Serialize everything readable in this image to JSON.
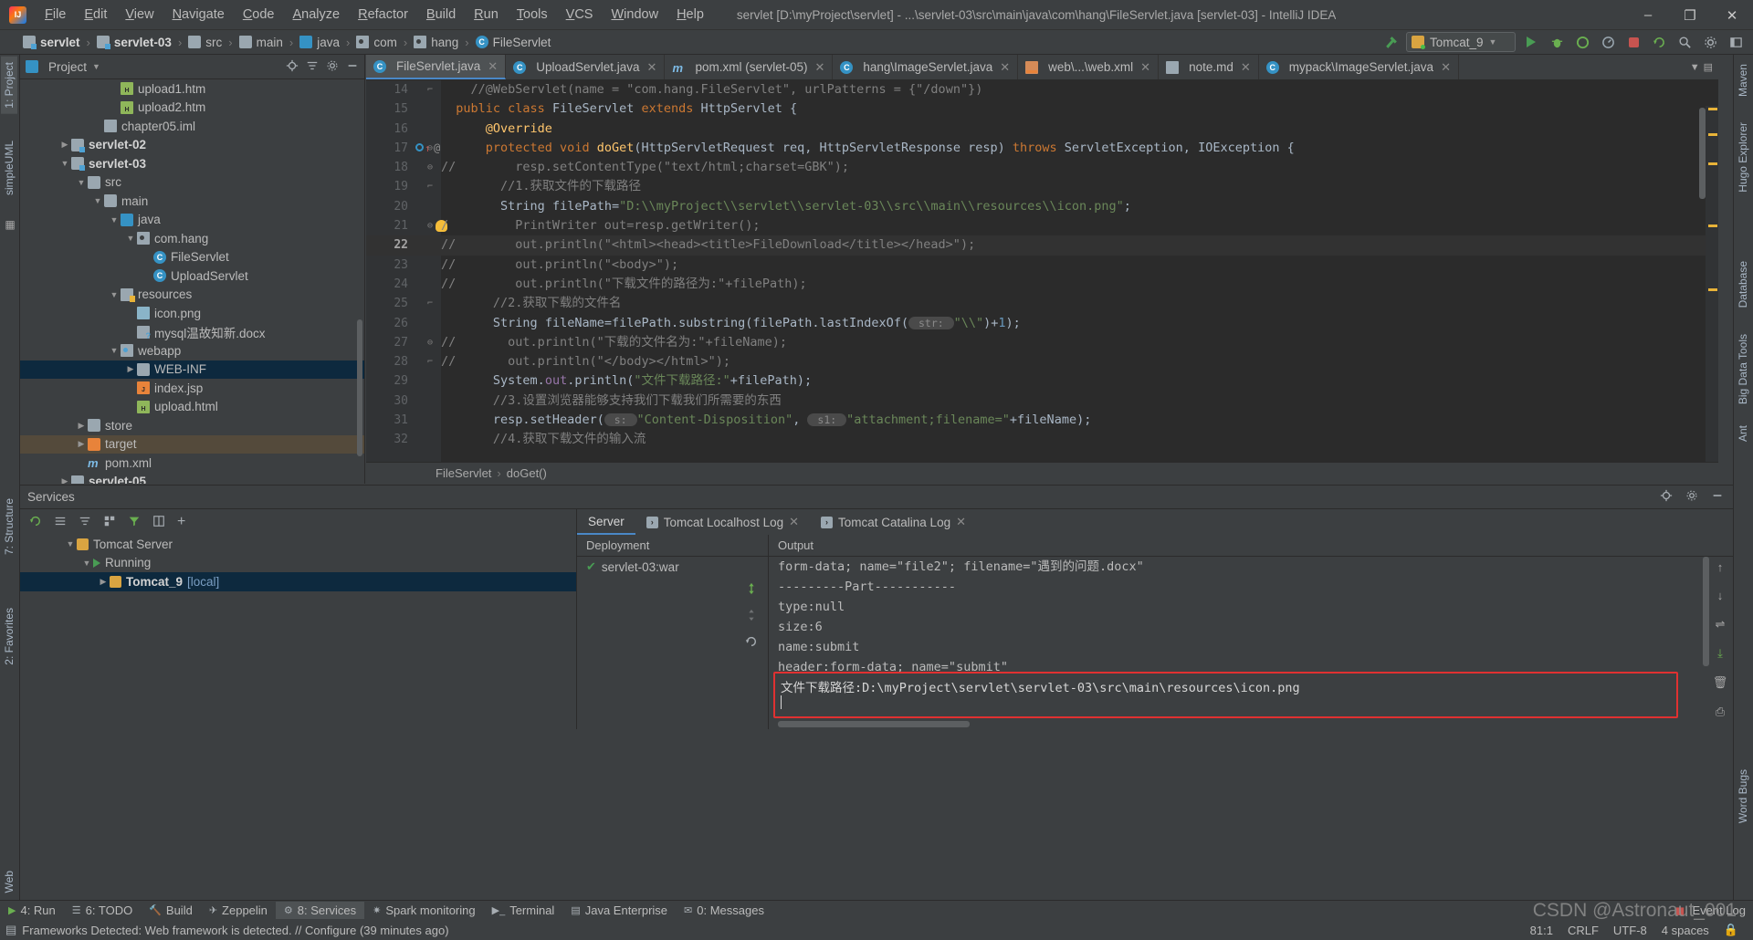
{
  "window": {
    "title": "servlet [D:\\myProject\\servlet] - ...\\servlet-03\\src\\main\\java\\com\\hang\\FileServlet.java [servlet-03] - IntelliJ IDEA",
    "minimize": "–",
    "maximize": "❐",
    "close": "✕"
  },
  "menu": [
    "File",
    "Edit",
    "View",
    "Navigate",
    "Code",
    "Analyze",
    "Refactor",
    "Build",
    "Run",
    "Tools",
    "VCS",
    "Window",
    "Help"
  ],
  "breadcrumbs": [
    {
      "label": "servlet",
      "icon": "module-folder-icon",
      "bold": true
    },
    {
      "label": "servlet-03",
      "icon": "module-folder-icon",
      "bold": true
    },
    {
      "label": "src",
      "icon": "folder-icon",
      "bold": false
    },
    {
      "label": "main",
      "icon": "folder-icon",
      "bold": false
    },
    {
      "label": "java",
      "icon": "source-folder-icon",
      "bold": false
    },
    {
      "label": "com",
      "icon": "package-icon",
      "bold": false
    },
    {
      "label": "hang",
      "icon": "package-icon",
      "bold": false
    },
    {
      "label": "FileServlet",
      "icon": "class-icon",
      "bold": false
    }
  ],
  "toolbar": {
    "run_config": "Tomcat_9",
    "build_hammer": "build-icon",
    "run": "run-icon",
    "debug": "debug-icon",
    "coverage": "coverage-icon",
    "profile": "profile-icon",
    "stop": "stop-icon",
    "updateapp": "update-app-icon",
    "search": "search-icon",
    "settings": "settings-icon",
    "layout": "layout-icon"
  },
  "project_panel": {
    "title": "Project",
    "tree": [
      {
        "label": "upload1.htm",
        "indent": 5,
        "arrow": "none",
        "icon": "html-file-icon",
        "bold": false,
        "state": "normal"
      },
      {
        "label": "upload2.htm",
        "indent": 5,
        "arrow": "none",
        "icon": "html-file-icon",
        "bold": false,
        "state": "normal"
      },
      {
        "label": "chapter05.iml",
        "indent": 4,
        "arrow": "none",
        "icon": "iml-file-icon",
        "bold": false,
        "state": "normal"
      },
      {
        "label": "servlet-02",
        "indent": 2,
        "arrow": "right",
        "icon": "module-folder-icon",
        "bold": true,
        "state": "normal"
      },
      {
        "label": "servlet-03",
        "indent": 2,
        "arrow": "down",
        "icon": "module-folder-icon",
        "bold": true,
        "state": "normal"
      },
      {
        "label": "src",
        "indent": 3,
        "arrow": "down",
        "icon": "folder-icon",
        "bold": false,
        "state": "normal"
      },
      {
        "label": "main",
        "indent": 4,
        "arrow": "down",
        "icon": "folder-icon",
        "bold": false,
        "state": "normal"
      },
      {
        "label": "java",
        "indent": 5,
        "arrow": "down",
        "icon": "source-folder-icon",
        "bold": false,
        "state": "normal"
      },
      {
        "label": "com.hang",
        "indent": 6,
        "arrow": "down",
        "icon": "package-icon",
        "bold": false,
        "state": "normal"
      },
      {
        "label": "FileServlet",
        "indent": 7,
        "arrow": "none",
        "icon": "class-icon",
        "bold": false,
        "state": "normal"
      },
      {
        "label": "UploadServlet",
        "indent": 7,
        "arrow": "none",
        "icon": "class-icon",
        "bold": false,
        "state": "normal"
      },
      {
        "label": "resources",
        "indent": 5,
        "arrow": "down",
        "icon": "resources-folder-icon",
        "bold": false,
        "state": "normal"
      },
      {
        "label": "icon.png",
        "indent": 6,
        "arrow": "none",
        "icon": "image-file-icon",
        "bold": false,
        "state": "normal"
      },
      {
        "label": "mysql温故知新.docx",
        "indent": 6,
        "arrow": "none",
        "icon": "docx-file-icon",
        "bold": false,
        "state": "normal"
      },
      {
        "label": "webapp",
        "indent": 5,
        "arrow": "down",
        "icon": "webapp-folder-icon",
        "bold": false,
        "state": "normal"
      },
      {
        "label": "WEB-INF",
        "indent": 6,
        "arrow": "right",
        "icon": "folder-icon",
        "bold": false,
        "state": "selected"
      },
      {
        "label": "index.jsp",
        "indent": 6,
        "arrow": "none",
        "icon": "jsp-file-icon",
        "bold": false,
        "state": "normal"
      },
      {
        "label": "upload.html",
        "indent": 6,
        "arrow": "none",
        "icon": "html-file-icon",
        "bold": false,
        "state": "normal"
      },
      {
        "label": "store",
        "indent": 3,
        "arrow": "right",
        "icon": "folder-icon",
        "bold": false,
        "state": "normal"
      },
      {
        "label": "target",
        "indent": 3,
        "arrow": "right",
        "icon": "target-folder-icon",
        "bold": false,
        "state": "highlighted"
      },
      {
        "label": "pom.xml",
        "indent": 3,
        "arrow": "none",
        "icon": "maven-icon",
        "bold": false,
        "state": "normal"
      },
      {
        "label": "servlet-05",
        "indent": 2,
        "arrow": "right",
        "icon": "module-folder-icon",
        "bold": true,
        "state": "normal"
      }
    ]
  },
  "editor": {
    "tabs": [
      {
        "label": "FileServlet.java",
        "icon": "class-icon",
        "active": true
      },
      {
        "label": "UploadServlet.java",
        "icon": "class-icon",
        "active": false
      },
      {
        "label": "pom.xml (servlet-05)",
        "icon": "maven-icon",
        "active": false
      },
      {
        "label": "hang\\ImageServlet.java",
        "icon": "class-icon",
        "active": false
      },
      {
        "label": "web\\...\\web.xml",
        "icon": "xml-file-icon",
        "active": false
      },
      {
        "label": "note.md",
        "icon": "md-file-icon",
        "active": false
      },
      {
        "label": "mypack\\ImageServlet.java",
        "icon": "class-icon",
        "active": false
      }
    ],
    "breadcrumb": [
      "FileServlet",
      "doGet()"
    ],
    "lines": [
      {
        "n": "14",
        "marks": {
          "fold": "⌐"
        },
        "tokens": [
          {
            "t": "    ",
            "c": "txt"
          },
          {
            "t": "//@WebServlet(name = \"com.hang.FileServlet\", urlPatterns = {\"/down\"})",
            "c": "cmt"
          }
        ]
      },
      {
        "n": "15",
        "marks": {},
        "tokens": [
          {
            "t": "  ",
            "c": "txt"
          },
          {
            "t": "public class ",
            "c": "kw"
          },
          {
            "t": "FileServlet ",
            "c": "txt"
          },
          {
            "t": "extends ",
            "c": "kw"
          },
          {
            "t": "HttpServlet {",
            "c": "txt"
          }
        ]
      },
      {
        "n": "16",
        "marks": {},
        "tokens": [
          {
            "t": "      ",
            "c": "txt"
          },
          {
            "t": "@Override",
            "c": "fn"
          }
        ]
      },
      {
        "n": "17",
        "marks": {
          "gutter": "override-marker",
          "fold": "⊖"
        },
        "tokens": [
          {
            "t": "      ",
            "c": "txt"
          },
          {
            "t": "protected void ",
            "c": "kw"
          },
          {
            "t": "doGet",
            "c": "fn"
          },
          {
            "t": "(HttpServletRequest req, HttpServletResponse resp) ",
            "c": "txt"
          },
          {
            "t": "throws ",
            "c": "kw"
          },
          {
            "t": "ServletException, IOException {",
            "c": "txt"
          }
        ]
      },
      {
        "n": "18",
        "marks": {
          "fold": "⊖"
        },
        "tokens": [
          {
            "t": "//        resp.setContentType(\"text/html;charset=GBK\");",
            "c": "cmt"
          }
        ]
      },
      {
        "n": "19",
        "marks": {
          "fold": "⌐"
        },
        "tokens": [
          {
            "t": "        ",
            "c": "txt"
          },
          {
            "t": "//1.获取文件的下载路径",
            "c": "cmt"
          }
        ]
      },
      {
        "n": "20",
        "marks": {},
        "tokens": [
          {
            "t": "        ",
            "c": "txt"
          },
          {
            "t": "String ",
            "c": "typ"
          },
          {
            "t": "filePath=",
            "c": "txt"
          },
          {
            "t": "\"D:\\\\myProject\\\\servlet\\\\servlet-03\\\\src\\\\main\\\\resources\\\\icon.png\"",
            "c": "str"
          },
          {
            "t": ";",
            "c": "txt"
          }
        ]
      },
      {
        "n": "21",
        "marks": {
          "fold": "⊖",
          "bulb": true
        },
        "tokens": [
          {
            "t": "/         PrintWriter out=resp.getWriter();",
            "c": "cmt"
          }
        ]
      },
      {
        "n": "22",
        "marks": {},
        "current": true,
        "tokens": [
          {
            "t": "//        out.println(\"<html><head><title>FileDownload</title></head>\");",
            "c": "cmt"
          }
        ]
      },
      {
        "n": "23",
        "marks": {},
        "tokens": [
          {
            "t": "//        out.println(\"<body>\");",
            "c": "cmt"
          }
        ]
      },
      {
        "n": "24",
        "marks": {},
        "tokens": [
          {
            "t": "//        out.println(\"下载文件的路径为:\"+filePath);",
            "c": "cmt"
          }
        ]
      },
      {
        "n": "25",
        "marks": {
          "fold": "⌐"
        },
        "tokens": [
          {
            "t": "       ",
            "c": "txt"
          },
          {
            "t": "//2.获取下载的文件名",
            "c": "cmt"
          }
        ]
      },
      {
        "n": "26",
        "marks": {},
        "tokens": [
          {
            "t": "       ",
            "c": "txt"
          },
          {
            "t": "String ",
            "c": "typ"
          },
          {
            "t": "fileName=filePath.substring(filePath.lastIndexOf(",
            "c": "txt"
          },
          {
            "t": " str: ",
            "c": "hint"
          },
          {
            "t": "\"\\\\\"",
            "c": "str"
          },
          {
            "t": ")+",
            "c": "txt"
          },
          {
            "t": "1",
            "c": "num"
          },
          {
            "t": ");",
            "c": "txt"
          }
        ]
      },
      {
        "n": "27",
        "marks": {
          "fold": "⊖"
        },
        "tokens": [
          {
            "t": "//       out.println(\"下载的文件名为:\"+fileName);",
            "c": "cmt"
          }
        ]
      },
      {
        "n": "28",
        "marks": {
          "fold": "⌐"
        },
        "tokens": [
          {
            "t": "//       out.println(\"</body></html>\");",
            "c": "cmt"
          }
        ]
      },
      {
        "n": "29",
        "marks": {},
        "tokens": [
          {
            "t": "       ",
            "c": "txt"
          },
          {
            "t": "System.",
            "c": "txt"
          },
          {
            "t": "out",
            "c": "fld"
          },
          {
            "t": ".println(",
            "c": "txt"
          },
          {
            "t": "\"文件下载路径:\"",
            "c": "str"
          },
          {
            "t": "+filePath);",
            "c": "txt"
          }
        ]
      },
      {
        "n": "30",
        "marks": {},
        "tokens": [
          {
            "t": "       ",
            "c": "txt"
          },
          {
            "t": "//3.设置浏览器能够支持我们下载我们所需要的东西",
            "c": "cmt"
          }
        ]
      },
      {
        "n": "31",
        "marks": {},
        "tokens": [
          {
            "t": "       ",
            "c": "txt"
          },
          {
            "t": "resp.setHeader(",
            "c": "txt"
          },
          {
            "t": " s: ",
            "c": "hint"
          },
          {
            "t": "\"Content-Disposition\"",
            "c": "str"
          },
          {
            "t": ", ",
            "c": "txt"
          },
          {
            "t": " s1: ",
            "c": "hint"
          },
          {
            "t": "\"attachment;filename=\"",
            "c": "str"
          },
          {
            "t": "+fileName);",
            "c": "txt"
          }
        ]
      },
      {
        "n": "32",
        "marks": {},
        "tokens": [
          {
            "t": "       ",
            "c": "txt"
          },
          {
            "t": "//4.获取下载文件的输入流",
            "c": "cmt"
          }
        ]
      }
    ]
  },
  "services": {
    "title": "Services",
    "tree": [
      {
        "label": "Tomcat Server",
        "indent": 1,
        "arrow": "down",
        "icon": "tomcat-icon",
        "bold": false,
        "state": "normal",
        "suffix": ""
      },
      {
        "label": "Running",
        "indent": 2,
        "arrow": "down",
        "icon": "run-icon",
        "bold": false,
        "state": "normal",
        "suffix": ""
      },
      {
        "label": "Tomcat_9",
        "indent": 3,
        "arrow": "right",
        "icon": "tomcat-icon",
        "bold": true,
        "state": "selected",
        "suffix": "[local]"
      }
    ],
    "tabs": [
      {
        "label": "Server",
        "active": true,
        "closable": false
      },
      {
        "label": "Tomcat Localhost Log",
        "active": false,
        "closable": true
      },
      {
        "label": "Tomcat Catalina Log",
        "active": false,
        "closable": true
      }
    ],
    "columns": {
      "deployment": "Deployment",
      "output": "Output"
    },
    "deployment_items": [
      {
        "label": "servlet-03:war",
        "status": "deployed"
      }
    ],
    "output_lines": [
      "form-data; name=\"file2\"; filename=\"遇到的问题.docx\"",
      "---------Part-----------",
      "type:null",
      "size:6",
      "name:submit",
      "header:form-data; name=\"submit\""
    ],
    "highlighted_output": "文件下载路径:D:\\myProject\\servlet\\servlet-03\\src\\main\\resources\\icon.png",
    "highlight_color": "#e03131"
  },
  "bottom_bar": {
    "tabs": [
      {
        "label": "4: Run",
        "icon": "run-icon",
        "active": false
      },
      {
        "label": "6: TODO",
        "icon": "todo-icon",
        "active": false
      },
      {
        "label": "Build",
        "icon": "build-icon",
        "active": false
      },
      {
        "label": "Zeppelin",
        "icon": "zeppelin-icon",
        "active": false
      },
      {
        "label": "8: Services",
        "icon": "services-icon",
        "active": true
      },
      {
        "label": "Spark monitoring",
        "icon": "spark-icon",
        "active": false
      },
      {
        "label": "Terminal",
        "icon": "terminal-icon",
        "active": false
      },
      {
        "label": "Java Enterprise",
        "icon": "java-enterprise-icon",
        "active": false
      },
      {
        "label": "0: Messages",
        "icon": "messages-icon",
        "active": false
      }
    ],
    "event_log": "Event Log"
  },
  "left_strip": {
    "tabs": [
      "1: Project",
      "simpleUML",
      "7: Structure",
      "2: Favorites",
      "Web"
    ]
  },
  "right_strip": {
    "tabs": [
      "Maven",
      "Hugo Explorer",
      "Database",
      "Big Data Tools",
      "Ant",
      "Word Bugs"
    ]
  },
  "status_bar": {
    "message": "Frameworks Detected: Web framework is detected. // Configure (39 minutes ago)",
    "position": "81:1",
    "line_sep": "CRLF",
    "encoding": "UTF-8",
    "indent": "4 spaces",
    "lock": "lock-icon"
  },
  "watermark": "CSDN @Astronaut_001"
}
